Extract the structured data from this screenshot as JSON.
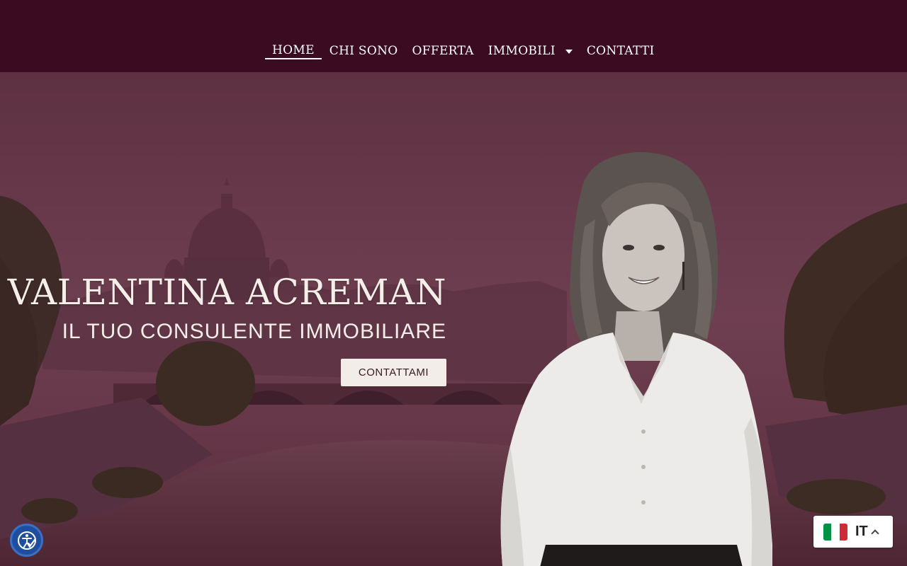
{
  "nav": {
    "items": [
      {
        "label": "HOME",
        "active": true
      },
      {
        "label": "CHI SONO",
        "active": false
      },
      {
        "label": "OFFERTA",
        "active": false
      },
      {
        "label": "IMMOBILI",
        "active": false,
        "has_dropdown": true
      },
      {
        "label": "CONTATTI",
        "active": false
      }
    ]
  },
  "hero": {
    "title": "VALENTINA ACREMAN",
    "subtitle": "IL TUO CONSULENTE IMMOBILIARE",
    "cta_label": "CONTATTAMI"
  },
  "language_selector": {
    "code": "IT",
    "flag_colors": [
      "#009246",
      "#ffffff",
      "#ce2b37"
    ]
  },
  "icons": {
    "accessibility": "accessibility-icon",
    "dropdown": "chevron-down-icon",
    "language_toggle": "chevron-up-icon"
  },
  "colors": {
    "header_bg": "#3b0c21",
    "hero_overlay": "#6a3a4d",
    "cta_bg": "#f3ede9",
    "text_light": "#f6efe9",
    "accessibility_blue": "#1f4e9e"
  }
}
